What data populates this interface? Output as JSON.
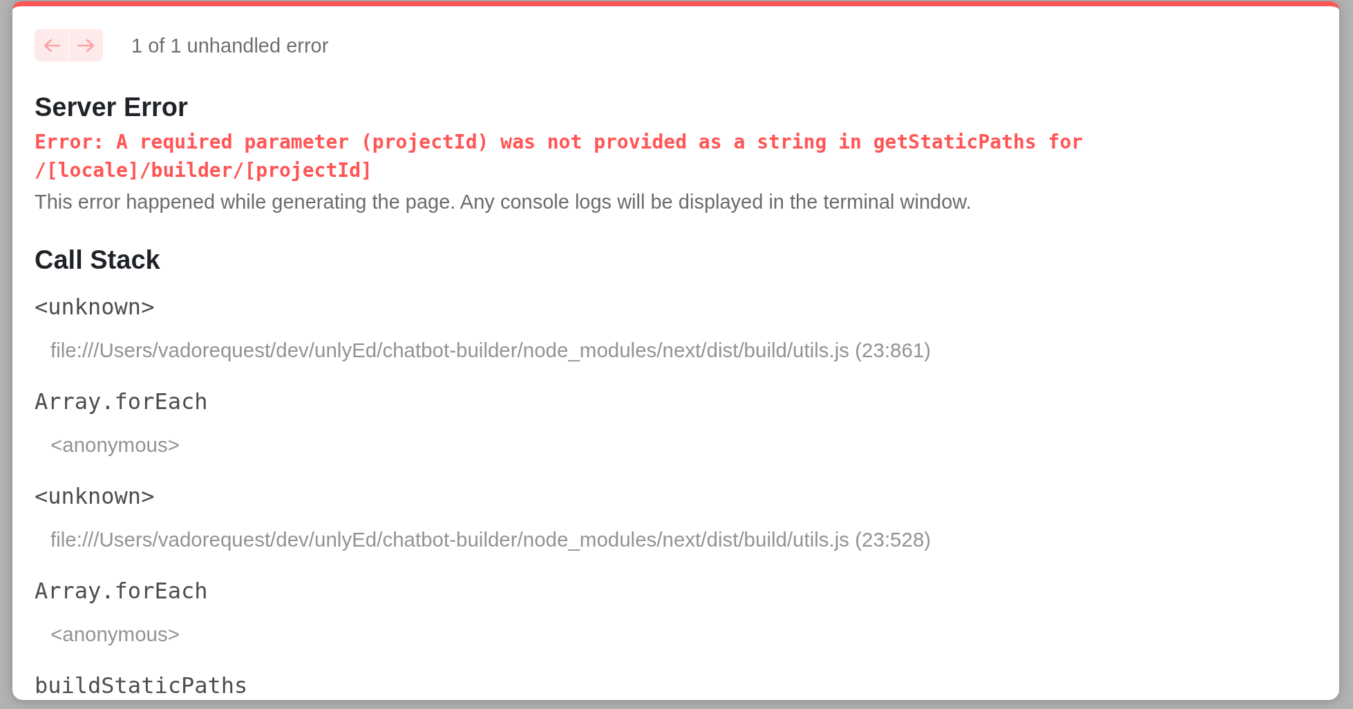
{
  "toolbar": {
    "nav_buttons": [
      {
        "kind": "previous",
        "disabled": true
      },
      {
        "kind": "next",
        "disabled": true
      }
    ],
    "counter": "1 of 1 unhandled error"
  },
  "title": "Server Error",
  "error_message": "Error: A required parameter (projectId) was not provided as a string in getStaticPaths for /[locale]/builder/[projectId]",
  "description": "This error happened while generating the page. Any console logs will be displayed in the terminal window.",
  "call_stack": {
    "heading": "Call Stack",
    "frames": [
      {
        "function": "<unknown>",
        "location": "file:///Users/vadorequest/dev/unlyEd/chatbot-builder/node_modules/next/dist/build/utils.js (23:861)"
      },
      {
        "function": "Array.forEach",
        "location": "<anonymous>"
      },
      {
        "function": "<unknown>",
        "location": "file:///Users/vadorequest/dev/unlyEd/chatbot-builder/node_modules/next/dist/build/utils.js (23:528)"
      },
      {
        "function": "Array.forEach",
        "location": "<anonymous>"
      },
      {
        "function": "buildStaticPaths"
      }
    ]
  }
}
